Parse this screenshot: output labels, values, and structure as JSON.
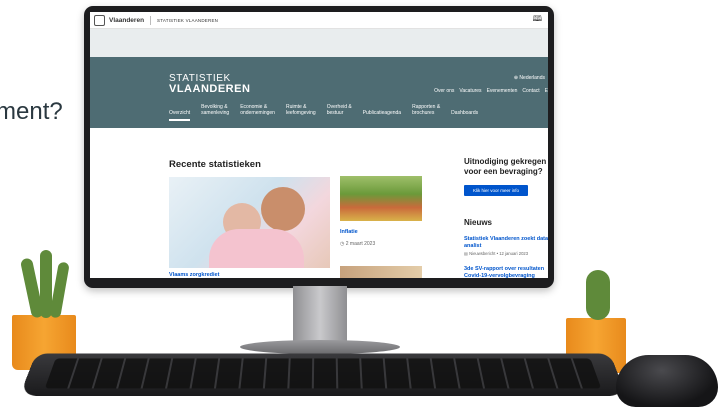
{
  "background_text": "ment?",
  "topbar": {
    "brand": "Vlaanderen",
    "subtitle": "STATISTIEK VLAANDEREN",
    "icon": "book-icon"
  },
  "header": {
    "brand_line1": "STATISTIEK",
    "brand_line2": "VLAANDEREN",
    "language": "⊕ Nederlands",
    "top_links": [
      "Over ons",
      "Vacatures",
      "Evenementen",
      "Contact",
      "E"
    ],
    "nav": [
      {
        "line1": "",
        "line2": "Overzicht",
        "active": true
      },
      {
        "line1": "Bevolking &",
        "line2": "samenleving",
        "active": false
      },
      {
        "line1": "Economie &",
        "line2": "ondernemingen",
        "active": false
      },
      {
        "line1": "Ruimte &",
        "line2": "leefomgeving",
        "active": false
      },
      {
        "line1": "Overheid &",
        "line2": "bestuur",
        "active": false
      },
      {
        "line1": "",
        "line2": "Publicatieagenda",
        "active": false
      },
      {
        "line1": "Rapporten &",
        "line2": "brochures",
        "active": false
      },
      {
        "line1": "",
        "line2": "Dashboards",
        "active": false
      }
    ]
  },
  "main": {
    "recent_title": "Recente statistieken",
    "cards": [
      {
        "title": "Inflatie",
        "date": "2 maart 2023"
      },
      {
        "title": "Vlaams zorgkrediet",
        "date": ""
      }
    ]
  },
  "aside": {
    "invite_title": "Uitnodiging gekregen voor een bevraging?",
    "invite_button": "Klik hier voor meer info",
    "news_title": "Nieuws",
    "news": [
      {
        "title": "Statistiek Vlaanderen zoekt data-analist",
        "meta": "Nieuwsbericht • 12 januari 2023"
      },
      {
        "title": "3de SV-rapport over resultaten Covid-19-vervolgbevraging",
        "meta": ""
      }
    ]
  },
  "colors": {
    "header": "#4e6c73",
    "link": "#0055cc",
    "button": "#0055cc"
  }
}
